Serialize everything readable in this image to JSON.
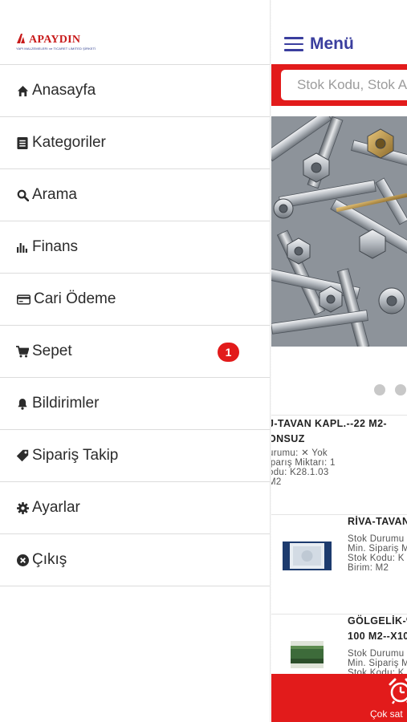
{
  "brand": {
    "name": "APAYDIN",
    "tagline": "YAPI MALZEMELERI ve TICARET LİMİTED ŞİRKETİ"
  },
  "drawer": {
    "items": [
      {
        "label": "Anasayfa",
        "icon": "home-icon"
      },
      {
        "label": "Kategoriler",
        "icon": "list-icon"
      },
      {
        "label": "Arama",
        "icon": "search-icon"
      },
      {
        "label": "Finans",
        "icon": "bar-chart-icon"
      },
      {
        "label": "Cari Ödeme",
        "icon": "credit-card-icon"
      },
      {
        "label": "Sepet",
        "icon": "cart-icon",
        "badge": "1"
      },
      {
        "label": "Bildirimler",
        "icon": "bell-icon"
      },
      {
        "label": "Sipariş Takip",
        "icon": "tag-icon"
      },
      {
        "label": "Ayarlar",
        "icon": "gear-icon"
      },
      {
        "label": "Çıkış",
        "icon": "close-circle-icon"
      }
    ]
  },
  "header": {
    "menu_label": "Menü"
  },
  "search": {
    "placeholder": "Stok Kodu, Stok Adı"
  },
  "products": [
    {
      "title_line1": "J-TAVAN KAPL.--22 M2-",
      "title_line2": "ONSUZ",
      "line1": "urumu: ✕ Yok",
      "line2": "iparış Miktarı: 1",
      "line3": "odu: K28.1.03",
      "line4": "M2"
    },
    {
      "title_line1": "RİVA-TAVAN",
      "line1": "Stok Durumu",
      "line2": "Min. Sipariş M",
      "line3": "Stok Kodu: K",
      "line4": "Birim: M2"
    },
    {
      "title_line1": "GÖLGELİK-%",
      "title_line2": "100 M2--X10",
      "line1": "Stok Durumu",
      "line2": "Min. Sipariş M",
      "line3": "Stok Kodu: K"
    }
  ],
  "bottom": {
    "label": "Çok sat",
    "icon": "alarm-clock-icon"
  },
  "colors": {
    "accent_red": "#e21b1b",
    "header_blue": "#3a3e9e"
  }
}
